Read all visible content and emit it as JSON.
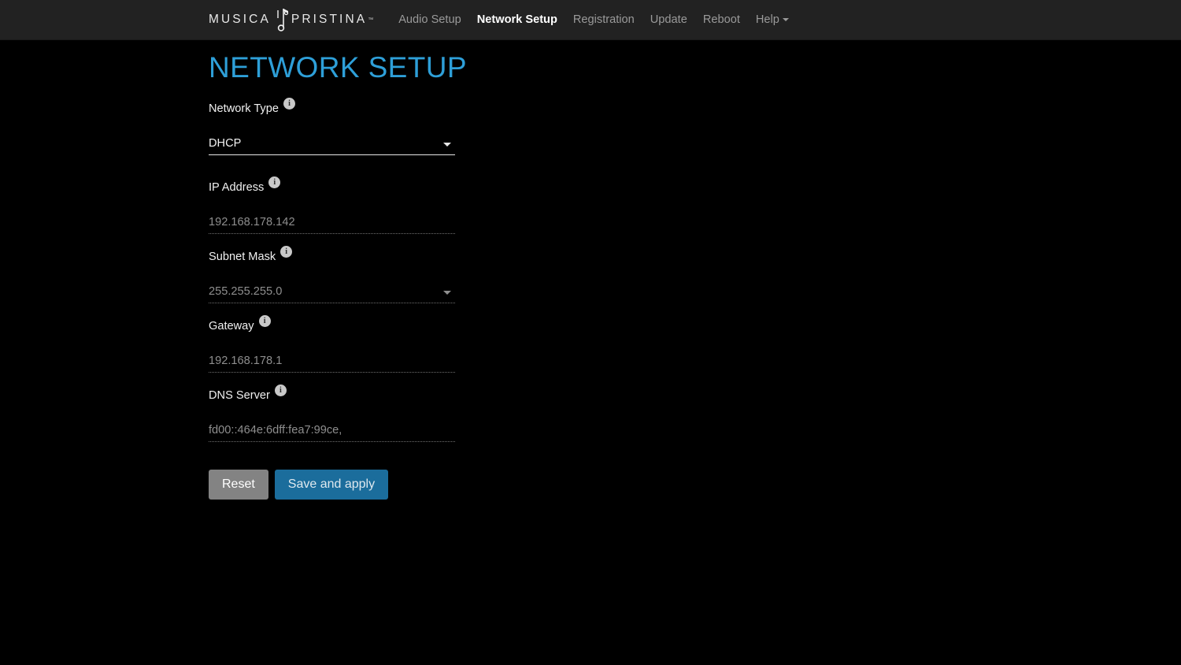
{
  "navbar": {
    "brand": {
      "word_left": "MUSICA",
      "word_right": "PRISTINA",
      "trademark": "™",
      "note_icon": "music-note-icon"
    },
    "links": [
      {
        "label": "Audio Setup",
        "active": false
      },
      {
        "label": "Network Setup",
        "active": true
      },
      {
        "label": "Registration",
        "active": false
      },
      {
        "label": "Update",
        "active": false
      },
      {
        "label": "Reboot",
        "active": false
      },
      {
        "label": "Help",
        "active": false,
        "has_caret": true
      }
    ]
  },
  "page": {
    "title": "NETWORK SETUP",
    "title_color": "#2e9fd8"
  },
  "form": {
    "network_type": {
      "label": "Network Type",
      "value": "DHCP",
      "type": "select",
      "enabled": true,
      "info_icon": "info-icon"
    },
    "ip_address": {
      "label": "IP Address",
      "value": "192.168.178.142",
      "type": "text",
      "enabled": false,
      "info_icon": "info-icon"
    },
    "subnet_mask": {
      "label": "Subnet Mask",
      "value": "255.255.255.0",
      "type": "select",
      "enabled": false,
      "info_icon": "info-icon"
    },
    "gateway": {
      "label": "Gateway",
      "value": "192.168.178.1",
      "type": "text",
      "enabled": false,
      "info_icon": "info-icon"
    },
    "dns_server": {
      "label": "DNS Server",
      "value": "fd00::464e:6dff:fea7:99ce,",
      "type": "text",
      "enabled": false,
      "info_icon": "info-icon"
    }
  },
  "buttons": {
    "reset": {
      "label": "Reset",
      "color": "#838383"
    },
    "save": {
      "label": "Save and apply",
      "color": "#1b6d9c"
    }
  }
}
